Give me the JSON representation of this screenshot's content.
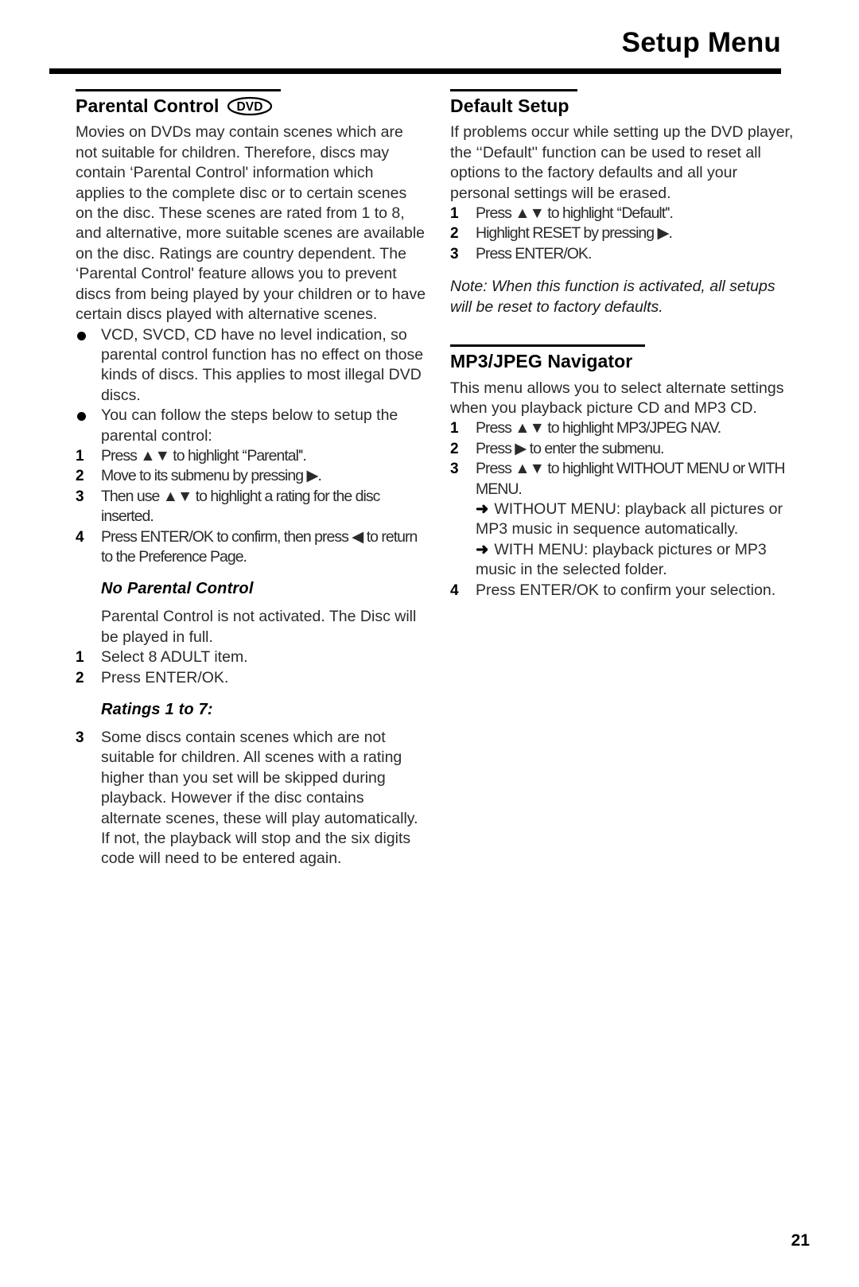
{
  "header": {
    "title": "Setup Menu"
  },
  "left_column": {
    "section_title": "Parental Control",
    "disc_badge": "DVD",
    "intro": "Movies on DVDs may contain scenes which are not suitable for children. Therefore, discs may contain ‘Parental Control' information which applies to the complete disc or to certain scenes on the disc. These scenes are rated from 1 to 8, and alternative, more suitable scenes are available on the disc. Ratings are country dependent. The ‘Parental Control' feature allows you to prevent discs from being played by your children or to have certain discs played with alternative scenes.",
    "bullets": [
      "VCD, SVCD, CD have no level indication, so parental control function has no effect on those kinds of discs. This applies to most illegal DVD discs.",
      "You can follow the steps below to setup the parental control:"
    ],
    "steps": [
      {
        "num": "1",
        "text": "Press ▲▼ to highlight ‘‘Parental''."
      },
      {
        "num": "2",
        "text": "Move to its submenu by pressing ▶."
      },
      {
        "num": "3",
        "text": "Then use ▲▼ to highlight a rating for the disc inserted."
      },
      {
        "num": "4",
        "text": "Press ENTER/OK to confirm, then press ◀ to return to the Preference Page."
      }
    ],
    "no_parental": {
      "heading": "No Parental Control",
      "body": "Parental Control is not activated. The Disc will be played in full.",
      "steps": [
        {
          "num": "1",
          "text": "Select 8 ADULT item."
        },
        {
          "num": "2",
          "text": "Press ENTER/OK."
        }
      ]
    },
    "ratings": {
      "heading": "Ratings 1 to 7:",
      "steps": [
        {
          "num": "3",
          "text": "Some discs contain scenes which are not suitable for children. All scenes with a rating higher than you set will be skipped during playback. However if the disc contains alternate scenes, these will play automatically. If not, the playback will stop and the six digits code will need to be entered again."
        }
      ]
    }
  },
  "right_column": {
    "default_setup": {
      "section_title": "Default Setup",
      "intro": "If problems occur while setting up the DVD player, the ‘‘Default'' function can be used to reset all options to the factory defaults and all your personal settings will be erased.",
      "steps": [
        {
          "num": "1",
          "text": "Press ▲▼ to highlight ‘‘Default''."
        },
        {
          "num": "2",
          "text": "Highlight RESET by pressing ▶."
        },
        {
          "num": "3",
          "text": "Press ENTER/OK."
        }
      ],
      "note": "Note: When this function is activated, all setups will be reset to factory defaults."
    },
    "mp3_navigator": {
      "section_title": "MP3/JPEG Navigator",
      "intro": "This menu allows you to select alternate settings when you playback picture CD and MP3 CD.",
      "steps": [
        {
          "num": "1",
          "text": "Press ▲▼ to highlight MP3/JPEG NAV."
        },
        {
          "num": "2",
          "text": "Press ▶ to enter the submenu."
        },
        {
          "num": "3",
          "text": "Press ▲▼ to highlight WITHOUT MENU or WITH MENU."
        }
      ],
      "arrow_items": [
        {
          "glyph": "➜",
          "text": "WITHOUT MENU: playback all pictures or MP3 music in sequence automatically."
        },
        {
          "glyph": "➜",
          "text": "WITH MENU: playback pictures or MP3 music in the selected folder."
        }
      ],
      "final_step": {
        "num": "4",
        "text": "Press ENTER/OK to confirm your selection."
      }
    }
  },
  "footer": {
    "page_number": "21"
  }
}
